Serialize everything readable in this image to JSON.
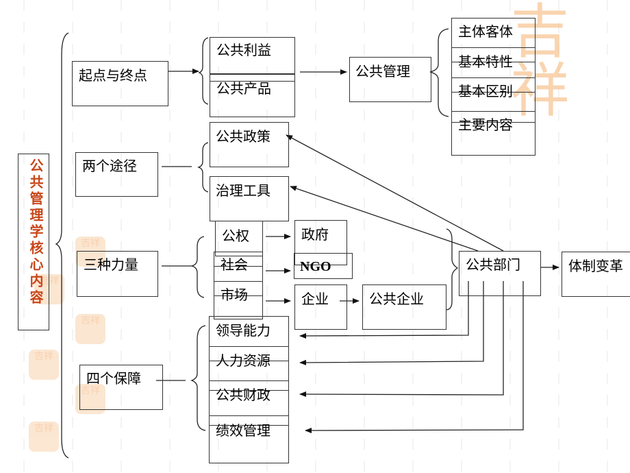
{
  "title": "公共管理学核心内容",
  "colors": {
    "title": "#c8461a",
    "watermark": "#f7c28f",
    "line": "#333333"
  },
  "watermark": {
    "large": "吉祥",
    "seal": "吉祥"
  },
  "sections": {
    "start_end": {
      "label": "起点与终点",
      "items": [
        "公共利益",
        "公共产品"
      ],
      "target": "公共管理",
      "sub_items": [
        "主体客体",
        "基本特性",
        "基本区别",
        "主要内容"
      ]
    },
    "two_paths": {
      "label": "两个途径",
      "items": [
        "公共政策",
        "治理工具"
      ]
    },
    "three_forces": {
      "label": "三种力量",
      "items": [
        "公权",
        "社会",
        "市场"
      ],
      "targets": [
        "政府",
        "NGO",
        "企业"
      ],
      "extra": "公共企业"
    },
    "four_guarantees": {
      "label": "四个保障",
      "items": [
        "领导能力",
        "人力资源",
        "公共财政",
        "绩效管理"
      ]
    }
  },
  "public_sector": "公共部门",
  "reform": "体制变革"
}
